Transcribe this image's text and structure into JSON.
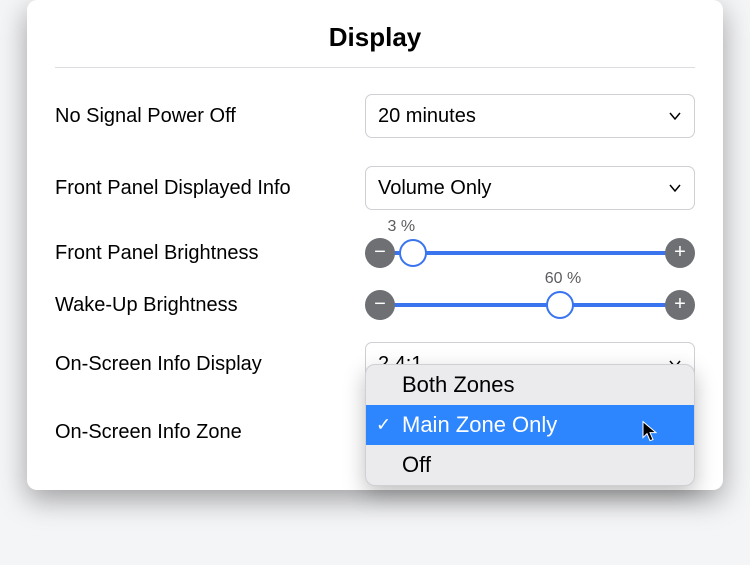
{
  "title": "Display",
  "rows": {
    "no_signal": {
      "label": "No Signal Power Off",
      "value": "20 minutes"
    },
    "front_info": {
      "label": "Front Panel Displayed Info",
      "value": "Volume Only"
    },
    "front_bright": {
      "label": "Front Panel Brightness",
      "percent": 3,
      "display": "3 %"
    },
    "wake_bright": {
      "label": "Wake-Up Brightness",
      "percent": 60,
      "display": "60 %"
    },
    "osd_display": {
      "label": "On-Screen Info Display",
      "value": "2.4:1"
    },
    "osd_zone": {
      "label": "On-Screen Info Zone",
      "value": "Main Zone Only",
      "options": [
        "Both Zones",
        "Main Zone Only",
        "Off"
      ],
      "selected_index": 1
    }
  },
  "glyphs": {
    "minus": "−",
    "plus": "+",
    "check": "✓"
  }
}
